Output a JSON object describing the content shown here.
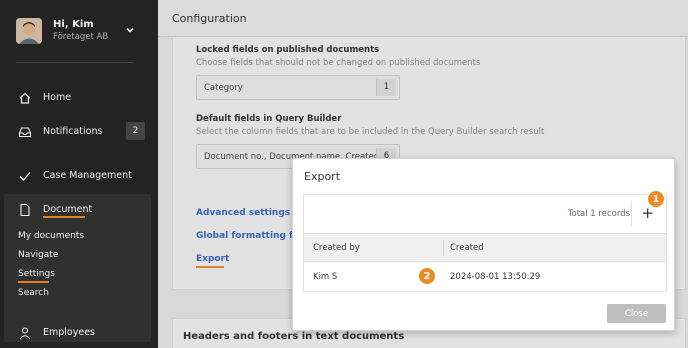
{
  "sidebar": {
    "user": {
      "name": "Hi, Kim",
      "org": "Företaget AB"
    },
    "nav": {
      "home": "Home",
      "notifications": "Notifications",
      "notifications_count": "2",
      "case_management": "Case Management",
      "document": "Document",
      "employees": "Employees"
    },
    "document_sub": [
      "My documents",
      "Navigate",
      "Settings",
      "Search"
    ]
  },
  "main": {
    "page_title": "Configuration",
    "locked": {
      "title": "Locked fields on published documents",
      "desc": "Choose fields that should not be changed on published documents",
      "field_text": "Category",
      "field_count": "1"
    },
    "default_fields": {
      "title": "Default fields in Query Builder",
      "desc": "Select the column fields that are to be included in the Query Builder search result",
      "field_text": "Document no., Document name, Created,",
      "field_count": "6"
    },
    "links": {
      "advanced": "Advanced settings",
      "global": "Global formatting for te",
      "export": "Export"
    },
    "section2_title": "Headers and footers in text documents"
  },
  "modal": {
    "title": "Export",
    "total": "Total 1 records",
    "add": "+",
    "columns": [
      "Created by",
      "Created"
    ],
    "row": {
      "created_by": "Kim S",
      "created": "2024-08-01 13:50:29"
    },
    "close_label": "Close"
  },
  "markers": [
    "1",
    "2"
  ],
  "colors": {
    "accent": "#f08a24",
    "sidebar": "#262626",
    "link": "#3a6ac4"
  }
}
